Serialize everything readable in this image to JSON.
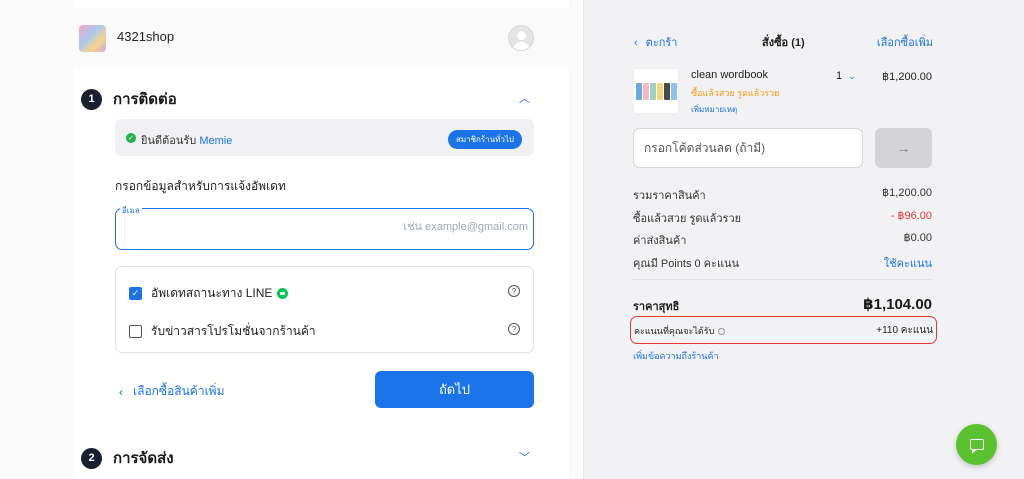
{
  "shop": {
    "name": "4321shop"
  },
  "steps": [
    {
      "number": "1",
      "title": "การติดต่อ"
    },
    {
      "number": "2",
      "title": "การจัดส่ง"
    }
  ],
  "welcome": {
    "greeting": "ยินดีต้อนรับ",
    "customer_name": "Memie",
    "badge": "สมาชิกร้านทั่วไป"
  },
  "contact": {
    "section_label": "กรอกข้อมูลสำหรับการแจ้งอัพเดท",
    "email_label": "อีเมล",
    "email_value": "",
    "email_placeholder": "เช่น example@gmail.com",
    "options": [
      {
        "label": "อัพเดทสถานะทาง LINE",
        "checked": true
      },
      {
        "label": "รับข่าวสารโปรโมชั่นจากร้านค้า",
        "checked": false
      }
    ],
    "help_glyph": "?"
  },
  "actions": {
    "back_label": "เลือกซื้อสินค้าเพิ่ม",
    "next_label": "ถัดไป"
  },
  "cart": {
    "back_label": "ตะกร้า",
    "title": "สั่งซื้อ (1)",
    "more_label": "เลือกซื้อเพิ่ม",
    "item": {
      "name": "clean wordbook",
      "promo": "ซื้อแล้วสวย รูดแล้วรวย",
      "note_link": "เพิ่มหมายเหตุ",
      "qty": "1",
      "price": "฿1,200.00"
    },
    "coupon_placeholder": "กรอกโค้ดส่วนลด (ถ้ามี)",
    "coupon_button": "→",
    "summary": [
      {
        "label": "รวมราคาสินค้า",
        "value": "฿1,200.00",
        "style": ""
      },
      {
        "label": "ซื้อแล้วสวย รูดแล้วรวย",
        "value": "- ฿96.00",
        "style": "red"
      },
      {
        "label": "ค่าส่งสินค้า",
        "value": "฿0.00",
        "style": ""
      },
      {
        "label": "คุณมี Points 0 คะแนน",
        "value": "ใช้คะแนน",
        "style": "blue"
      }
    ],
    "net_label": "ราคาสุทธิ",
    "net_value": "฿1,104.00",
    "points_label": "คะแนนที่คุณจะได้รับ",
    "points_value": "+110 คะแนน",
    "add_note_link": "เพิ่มข้อความถึงร้านค้า"
  },
  "colors": {
    "accent": "#1a73e8",
    "fab": "#5ac12f",
    "highlight": "#e53935",
    "promo": "#f29b0f"
  },
  "icons": [
    "shop-logo",
    "user-avatar-icon",
    "check-circle-icon",
    "line-icon",
    "help-icon",
    "chevron-up-icon",
    "chevron-down-icon",
    "chevron-left-icon",
    "arrow-right-icon",
    "chat-icon",
    "info-icon"
  ]
}
